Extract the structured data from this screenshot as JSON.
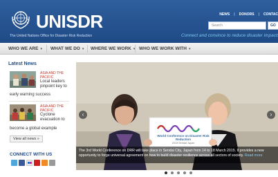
{
  "header": {
    "logo_text": "UNISDR",
    "logo_subtitle": "The United Nations Office for Disaster Risk Reduction",
    "top_links": [
      "NEWS",
      "DONORS",
      "CONTAC"
    ],
    "search_placeholder": "Search",
    "go_label": "GO",
    "tagline": "Connect and convince to reduce disaster impacts"
  },
  "nav": {
    "items": [
      "WHO WE ARE",
      "WHAT WE DO",
      "WHERE WE WORK",
      "WHO WE WORK WITH"
    ]
  },
  "sidebar": {
    "latest_title": "Latest News",
    "news": [
      {
        "category": "ASIA AND THE PACIFIC",
        "text_short": "Local leaders pinpoint key to",
        "text_tail": "early warning success"
      },
      {
        "category": "ASIA AND THE PACIFIC",
        "text_short": "Cyclone evacuation to",
        "text_tail": "become a global example"
      }
    ],
    "view_all": "View all news »",
    "connect_title": "CONNECT WITH US",
    "social_icons": [
      "twitter-icon",
      "facebook-icon",
      "flickr-icon",
      "youtube-icon",
      "rss-icon",
      "email-icon"
    ]
  },
  "slider": {
    "caption": "The 3rd World Conference on DRR will take place in Sendai City, Japan from 14 to 18 March 2015. It provides a new opportunity to forge universal agreement on how to build disaster resilience across all sectors of society.",
    "more_link": "Read more",
    "sign_text": "World Conference on Disaster Risk Reduction",
    "sign_sub": "2015 Sendai Japan",
    "dots_count": 5,
    "active_dot": 0
  },
  "colors": {
    "header_blue": "#1f4a85",
    "tagline": "#7fc7ee",
    "category_red": "#c0392b"
  }
}
